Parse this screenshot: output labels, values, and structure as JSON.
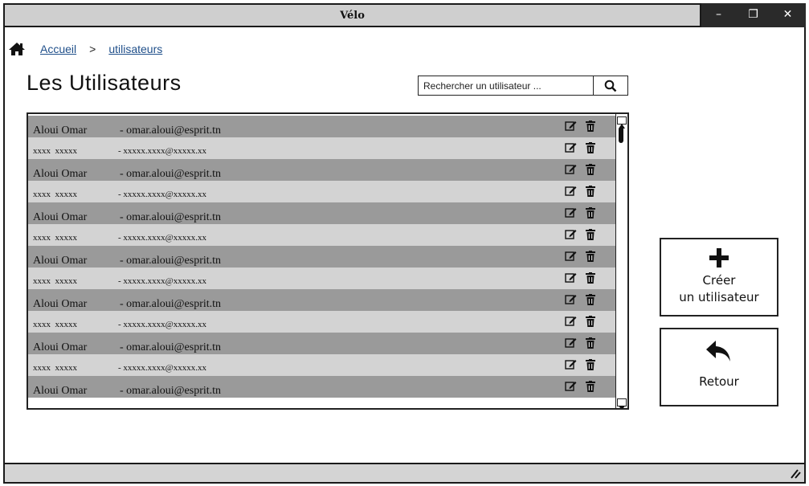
{
  "window": {
    "title": "Vélo"
  },
  "breadcrumb": {
    "home": "Accueil",
    "separator": ">",
    "current": "utilisateurs"
  },
  "page": {
    "title": "Les Utilisateurs"
  },
  "search": {
    "placeholder": "Rechercher un utilisateur ..."
  },
  "users": [
    {
      "name": "Aloui Omar",
      "email": "- omar.aloui@esprit.tn"
    },
    {
      "name": "xxxx  xxxxx",
      "email": "- xxxxx.xxxx@xxxxx.xx"
    },
    {
      "name": "Aloui Omar",
      "email": "- omar.aloui@esprit.tn"
    },
    {
      "name": "xxxx  xxxxx",
      "email": "- xxxxx.xxxx@xxxxx.xx"
    },
    {
      "name": "Aloui Omar",
      "email": "- omar.aloui@esprit.tn"
    },
    {
      "name": "xxxx  xxxxx",
      "email": "- xxxxx.xxxx@xxxxx.xx"
    },
    {
      "name": "Aloui Omar",
      "email": "- omar.aloui@esprit.tn"
    },
    {
      "name": "xxxx  xxxxx",
      "email": "- xxxxx.xxxx@xxxxx.xx"
    },
    {
      "name": "Aloui Omar",
      "email": "- omar.aloui@esprit.tn"
    },
    {
      "name": "xxxx  xxxxx",
      "email": "- xxxxx.xxxx@xxxxx.xx"
    },
    {
      "name": "Aloui Omar",
      "email": "- omar.aloui@esprit.tn"
    },
    {
      "name": "xxxx  xxxxx",
      "email": "- xxxxx.xxxx@xxxxx.xx"
    },
    {
      "name": "Aloui Omar",
      "email": "- omar.aloui@esprit.tn"
    }
  ],
  "actions": {
    "create_line1": "Créer",
    "create_line2": "un utilisateur",
    "back": "Retour"
  },
  "colors": {
    "row_dark": "#9a9a9a",
    "row_light": "#d3d3d3",
    "titlebar": "#cfcfcf",
    "link": "#1f4f8a"
  }
}
